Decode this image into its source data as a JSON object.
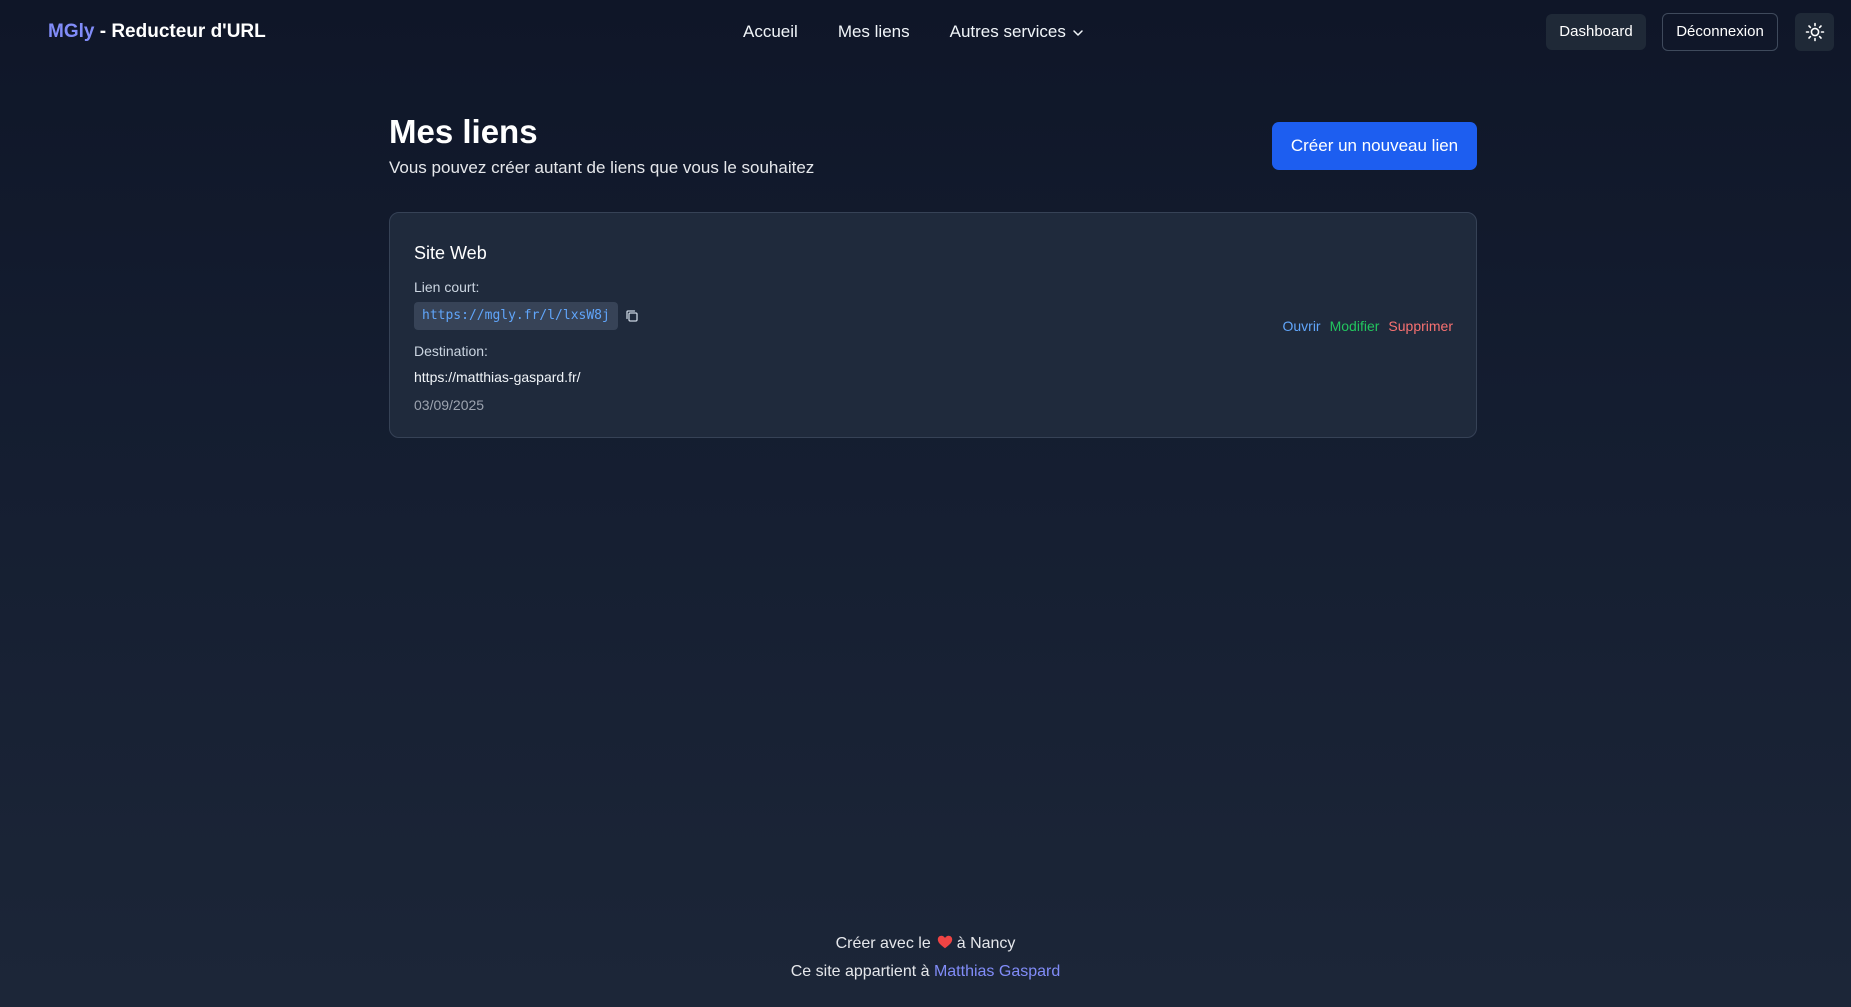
{
  "header": {
    "brand_accent": "MGly",
    "brand_rest": " - Reducteur d'URL",
    "nav": {
      "home": "Accueil",
      "links": "Mes liens",
      "services": "Autres services"
    },
    "dashboard_label": "Dashboard",
    "logout_label": "Déconnexion",
    "theme_icon": "sun-icon"
  },
  "main": {
    "title": "Mes liens",
    "subtitle": "Vous pouvez créer autant de liens que vous le souhaitez",
    "create_label": "Créer un nouveau lien"
  },
  "links": [
    {
      "name": "Site Web",
      "short_label": "Lien court:",
      "short_url": "https://mgly.fr/l/lxsW8j",
      "dest_label": "Destination:",
      "dest_url": "https://matthias-gaspard.fr/",
      "date": "03/09/2025",
      "actions": {
        "open": "Ouvrir",
        "edit": "Modifier",
        "delete": "Supprimer"
      }
    }
  ],
  "footer": {
    "made_prefix": "Créer avec le",
    "made_suffix": "à Nancy",
    "owner_prefix": "Ce site appartient à",
    "owner_link": "Matthias Gaspard"
  },
  "colors": {
    "accent": "#818cf8",
    "primary_button": "#1d5ef0",
    "open": "#60a5fa",
    "edit": "#22c55e",
    "delete": "#f87171",
    "heart": "#ef4444"
  }
}
